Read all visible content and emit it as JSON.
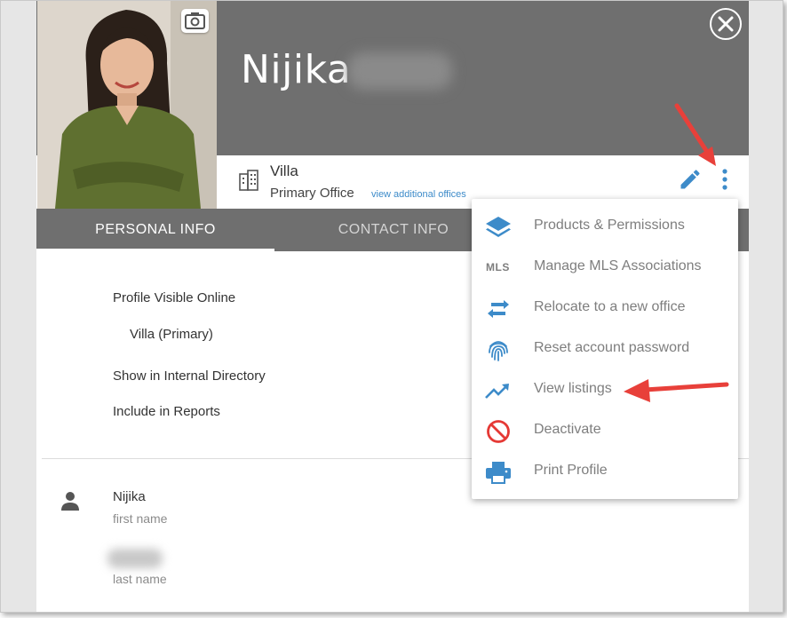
{
  "profile": {
    "first_name": "Nijika",
    "office": {
      "name": "Villa",
      "role": "Primary Office",
      "link": "view additional offices"
    }
  },
  "tabs": [
    {
      "label": "PERSONAL INFO",
      "active": true
    },
    {
      "label": "CONTACT INFO",
      "active": false
    }
  ],
  "personal": {
    "profile_visible": "Profile Visible Online",
    "office_primary": "Villa (Primary)",
    "internal_directory": "Show in Internal Directory",
    "include_reports": "Include in Reports",
    "first_name_value": "Nijika",
    "first_name_label": "first name",
    "last_name_label": "last name"
  },
  "menu": {
    "items": [
      {
        "label": "Products & Permissions",
        "icon": "layers-icon"
      },
      {
        "label": "Manage MLS Associations",
        "icon": "mls-icon",
        "icon_text": "MLS"
      },
      {
        "label": "Relocate to a new office",
        "icon": "swap-arrows-icon"
      },
      {
        "label": "Reset account password",
        "icon": "fingerprint-icon"
      },
      {
        "label": "View listings",
        "icon": "trending-up-icon"
      },
      {
        "label": "Deactivate",
        "icon": "block-icon"
      },
      {
        "label": "Print Profile",
        "icon": "printer-icon"
      }
    ]
  },
  "colors": {
    "header_gray": "#6f6f6f",
    "accent_blue": "#3d8bc9",
    "deactivate_red": "#e53935",
    "annotation_red": "#e8403a"
  }
}
